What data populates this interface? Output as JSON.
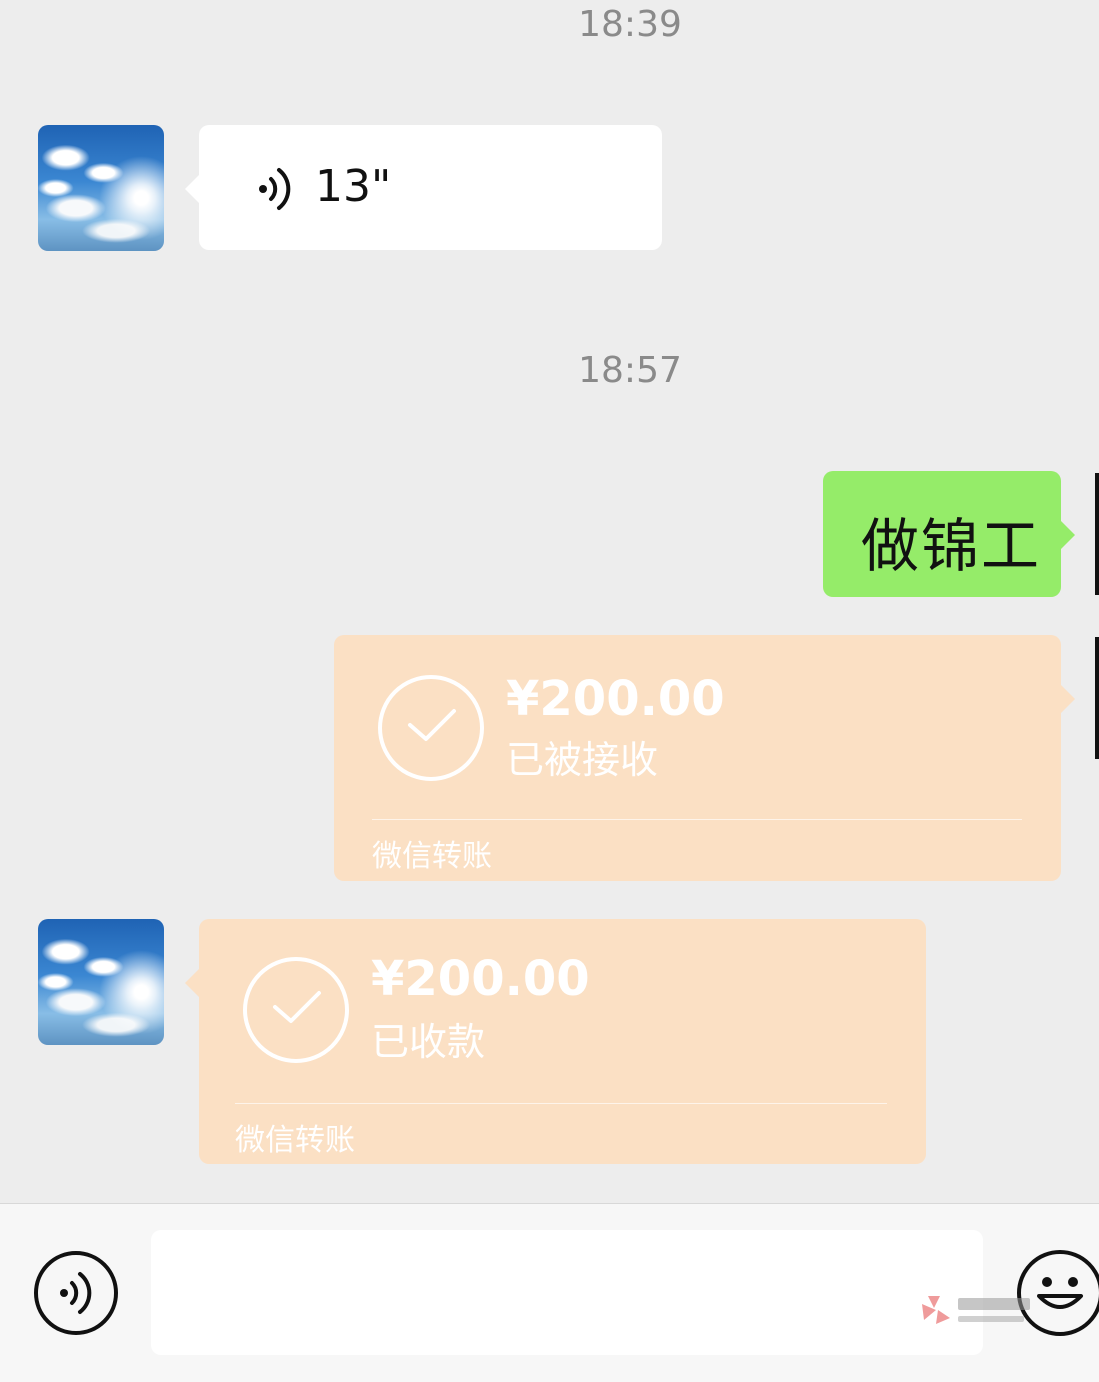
{
  "chat": {
    "timestamps": [
      "18:39",
      "18:57"
    ],
    "voice_message": {
      "duration": "13\"",
      "icon": "voice-waves-icon"
    },
    "sent_text": "做锦工",
    "transfer_sent": {
      "amount": "¥200.00",
      "status": "已被接收",
      "label": "微信转账",
      "icon": "check-circle-icon"
    },
    "transfer_received": {
      "amount": "¥200.00",
      "status": "已收款",
      "label": "微信转账",
      "icon": "check-circle-icon"
    }
  },
  "input_bar": {
    "voice_toggle_icon": "voice-toggle-icon",
    "emoji_icon": "emoji-smiley-icon",
    "message_value": ""
  },
  "colors": {
    "background": "#ededed",
    "sent_bubble": "#95ec69",
    "incoming_bubble": "#ffffff",
    "transfer_bubble": "#fbe0c4"
  }
}
